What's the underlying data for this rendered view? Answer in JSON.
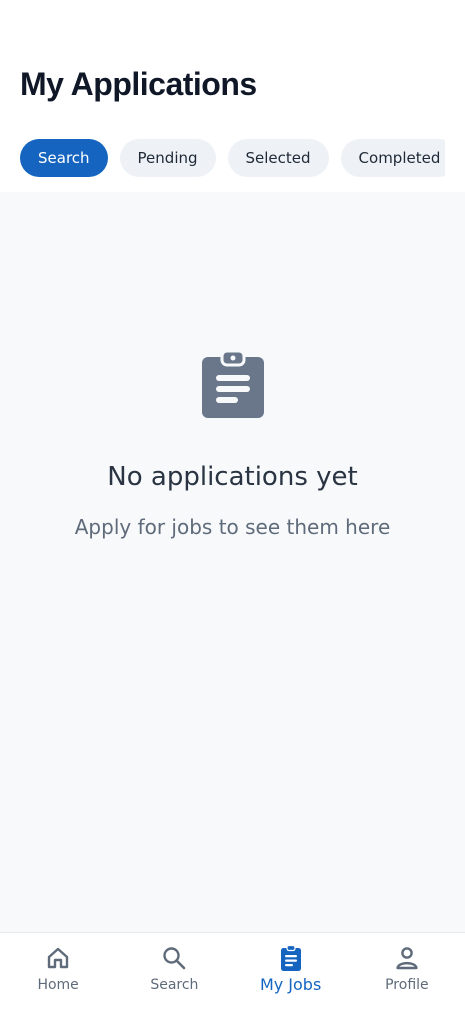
{
  "header": {
    "title": "My Applications"
  },
  "tabs": [
    {
      "label": "Search",
      "active": true
    },
    {
      "label": "Pending",
      "active": false
    },
    {
      "label": "Selected",
      "active": false
    },
    {
      "label": "Completed",
      "active": false
    }
  ],
  "empty_state": {
    "icon": "clipboard-icon",
    "title": "No applications yet",
    "subtitle": "Apply for jobs to see them here"
  },
  "bottom_nav": [
    {
      "label": "Home",
      "icon": "home-icon",
      "active": false
    },
    {
      "label": "Search",
      "icon": "search-icon",
      "active": false
    },
    {
      "label": "My Jobs",
      "icon": "clipboard-icon",
      "active": true
    },
    {
      "label": "Profile",
      "icon": "person-icon",
      "active": false
    }
  ],
  "colors": {
    "accent": "#1565c0",
    "tab_inactive_bg": "#eef2f6",
    "content_bg": "#f7f9fb",
    "icon_muted": "#6a778b"
  }
}
